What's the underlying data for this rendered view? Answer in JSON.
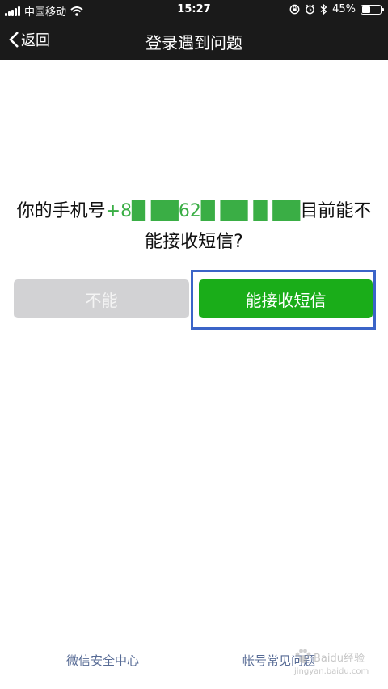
{
  "status_bar": {
    "carrier": "中国移动",
    "time": "15:27",
    "battery_percent": "45%",
    "battery_level": 0.45
  },
  "nav": {
    "back_label": "返回",
    "title": "登录遇到问题"
  },
  "question": {
    "prefix": "你的手机号",
    "phone_number": "+8█ ██62█ ██ █ ██",
    "suffix": "目前能不能接收短信?"
  },
  "buttons": {
    "cannot_label": "不能",
    "can_label": "能接收短信"
  },
  "footer": {
    "security_center": "微信安全中心",
    "account_faq": "帐号常见问题"
  },
  "watermark": {
    "text": "Baidu经验",
    "url_text": "jingyan.baidu.com"
  },
  "colors": {
    "bar_background": "#1a1a1a",
    "primary_green": "#1aad19",
    "disabled_gray": "#d2d2d4",
    "link_blue": "#576b95",
    "highlight_blue": "#3b64c8",
    "phone_green": "#3aae45"
  }
}
